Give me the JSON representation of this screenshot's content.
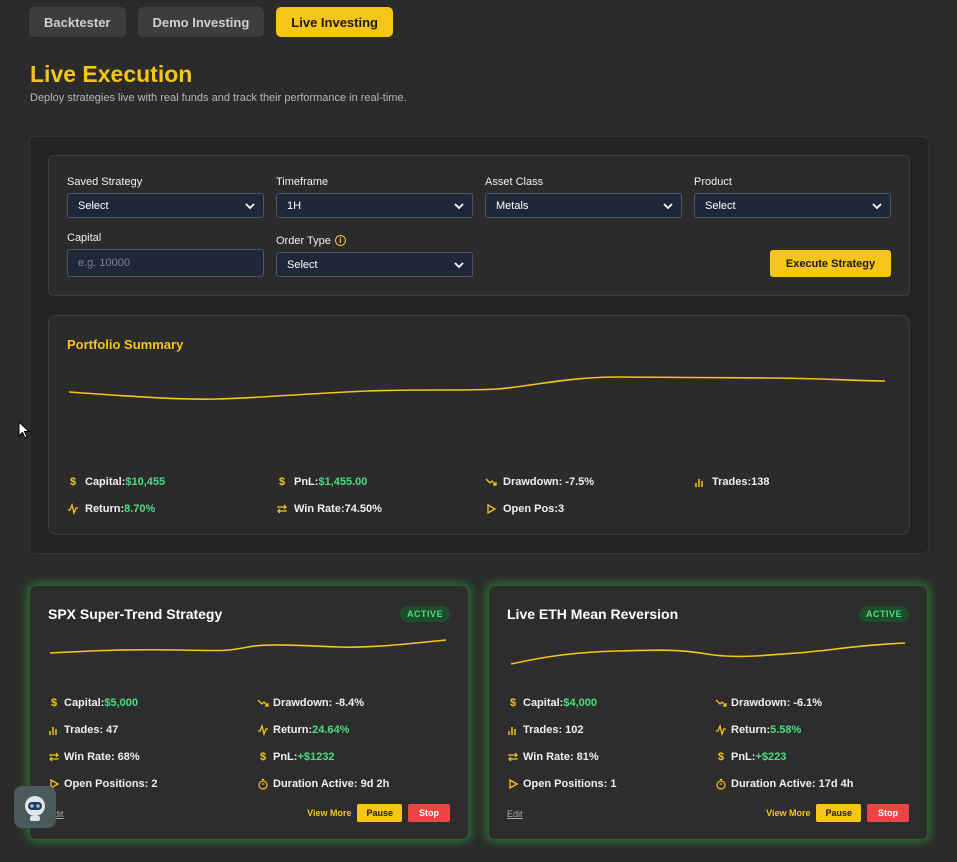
{
  "tabs": [
    {
      "label": "Backtester"
    },
    {
      "label": "Demo Investing"
    },
    {
      "label": "Live Investing"
    }
  ],
  "page": {
    "title": "Live Execution",
    "subtitle": "Deploy strategies live with real funds and track their performance in real-time."
  },
  "form": {
    "saved_strategy": {
      "label": "Saved Strategy",
      "value": "Select"
    },
    "timeframe": {
      "label": "Timeframe",
      "value": "1H"
    },
    "asset_class": {
      "label": "Asset Class",
      "value": "Metals"
    },
    "product": {
      "label": "Product",
      "value": "Select"
    },
    "capital": {
      "label": "Capital",
      "placeholder": "e.g. 10000"
    },
    "order_type": {
      "label": "Order Type",
      "value": "Select"
    },
    "execute_label": "Execute Strategy"
  },
  "summary": {
    "title": "Portfolio Summary",
    "capital_label": "Capital:",
    "capital_value": "$10,455",
    "pnl_label": "PnL:",
    "pnl_value": "$1,455.00",
    "drawdown": "Drawdown: -7.5%",
    "trades": "Trades:138",
    "return_label": "Return:",
    "return_value": "8.70%",
    "winrate": "Win Rate:74.50%",
    "openpos": "Open Pos:3"
  },
  "cards": [
    {
      "title": "SPX Super-Trend Strategy",
      "badge": "ACTIVE",
      "capital_label": "Capital:",
      "capital_value": "$5,000",
      "drawdown": "Drawdown: -8.4%",
      "trades": "Trades: 47",
      "return_label": "Return:",
      "return_value": "24.64%",
      "winrate": "Win Rate: 68%",
      "pnl_label": "PnL:",
      "pnl_value": "+$1232",
      "openpos": "Open Positions: 2",
      "duration": "Duration Active: 9d 2h",
      "edit": "Edit",
      "viewmore": "View More",
      "pause": "Pause",
      "stop": "Stop"
    },
    {
      "title": "Live ETH Mean Reversion",
      "badge": "ACTIVE",
      "capital_label": "Capital:",
      "capital_value": "$4,000",
      "drawdown": "Drawdown: -6.1%",
      "trades": "Trades: 102",
      "return_label": "Return:",
      "return_value": "5.58%",
      "winrate": "Win Rate: 81%",
      "pnl_label": "PnL:",
      "pnl_value": "+$223",
      "openpos": "Open Positions: 1",
      "duration": "Duration Active: 17d 4h",
      "edit": "Edit",
      "viewmore": "View More",
      "pause": "Pause",
      "stop": "Stop"
    }
  ],
  "colors": {
    "accent": "#f5c518",
    "positive": "#4ade80",
    "danger": "#ef4444"
  }
}
